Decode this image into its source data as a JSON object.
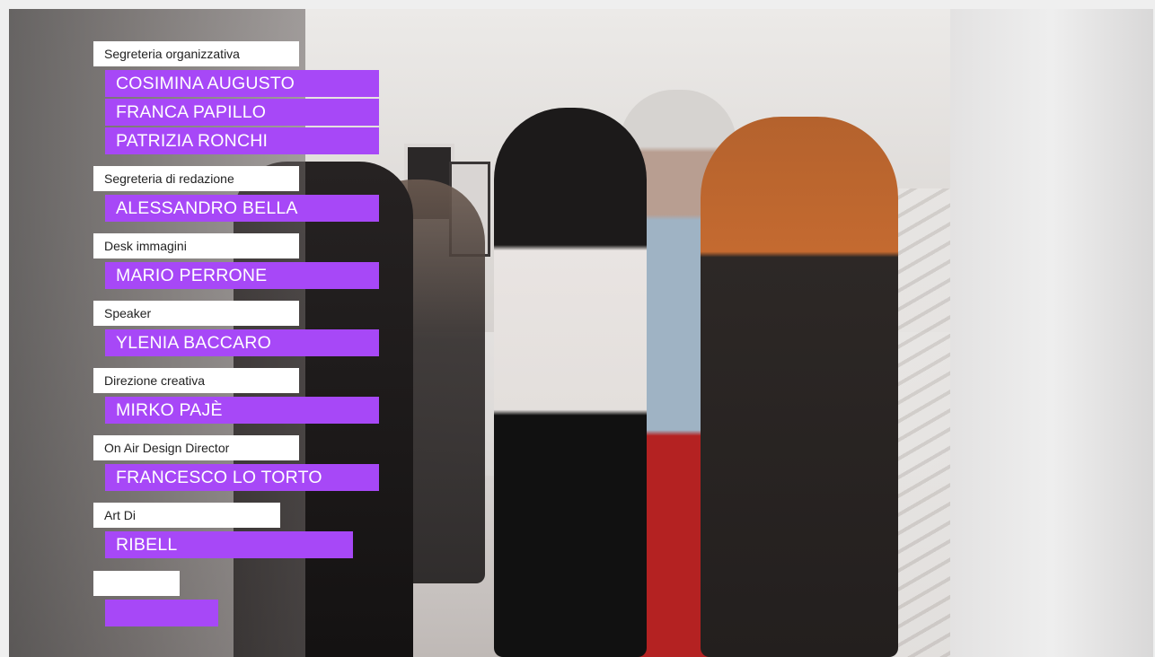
{
  "overlay": {
    "accent_color": "#a748f7",
    "label_bg_color": "#ffffff",
    "groups": [
      {
        "role": "Segreteria organizzativa",
        "names": [
          "COSIMINA AUGUSTO",
          "FRANCA  PAPILLO",
          "PATRIZIA RONCHI"
        ]
      },
      {
        "role": "Segreteria di redazione",
        "names": [
          "ALESSANDRO BELLA"
        ]
      },
      {
        "role": "Desk immagini",
        "names": [
          "MARIO PERRONE"
        ]
      },
      {
        "role": "Speaker",
        "names": [
          "YLENIA BACCARO"
        ]
      },
      {
        "role": "Direzione creativa",
        "names": [
          "MIRKO PAJÈ"
        ]
      },
      {
        "role": "On Air Design Director",
        "names": [
          "FRANCESCO LO TORTO"
        ]
      },
      {
        "role": "Art Di",
        "names": [
          "RIBELL"
        ]
      },
      {
        "role": "",
        "names": [
          ""
        ]
      }
    ]
  }
}
